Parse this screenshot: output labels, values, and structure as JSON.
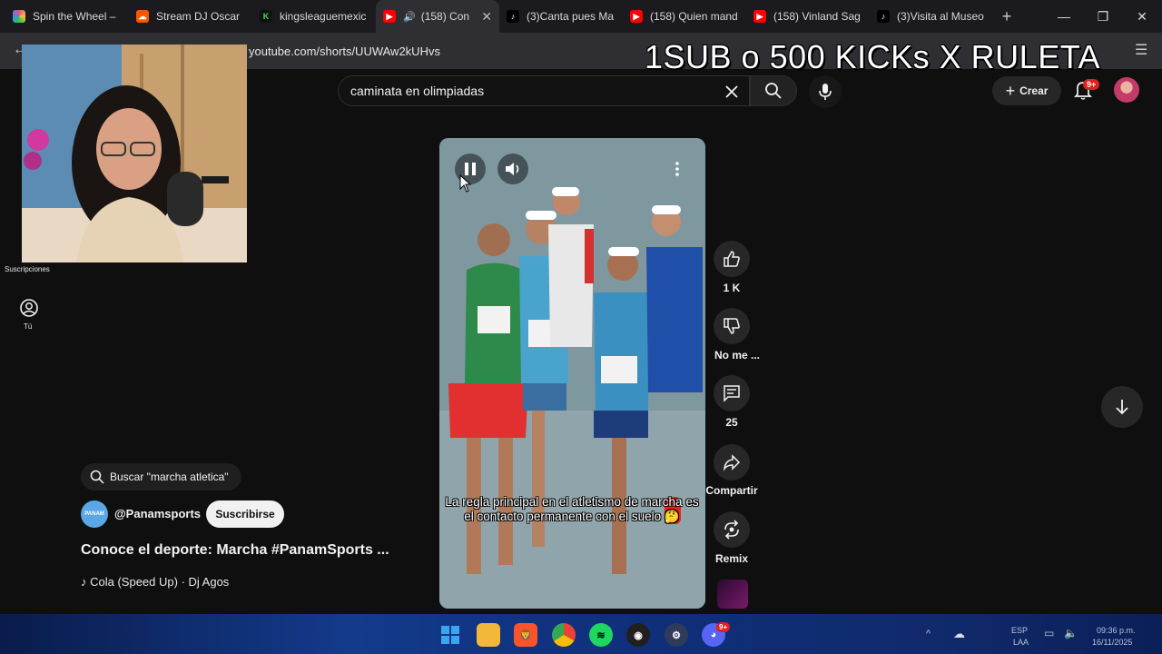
{
  "tabs": [
    {
      "label": "Spin the Wheel – ",
      "favicon": "colorful-wheel-icon",
      "color": "#e84a8a"
    },
    {
      "label": "Stream DJ Oscar",
      "favicon": "soundcloud-icon",
      "color": "#ff5500"
    },
    {
      "label": "kingsleaguemexic",
      "favicon": "kings-league-icon",
      "color": "#36c24a"
    },
    {
      "label": "(158) Con",
      "favicon": "youtube-icon",
      "color": "#ff0000",
      "active": true
    },
    {
      "label": "(3)Canta pues Ma",
      "favicon": "tiktok-icon",
      "color": "#000000"
    },
    {
      "label": "(158) Quien mand",
      "favicon": "youtube-icon",
      "color": "#ff0000"
    },
    {
      "label": "(158) Vinland Sag",
      "favicon": "youtube-icon",
      "color": "#ff0000"
    },
    {
      "label": "(3)Visita al Museo",
      "favicon": "tiktok-icon",
      "color": "#000000"
    }
  ],
  "address": {
    "url": "youtube.com/shorts/UUWAw2kUHvs"
  },
  "overlay_banner": "1SUB o 500 KICKs X RULETA",
  "header": {
    "search_query": "caminata en olimpiadas",
    "create_label": "Crear",
    "notification_count": "9+"
  },
  "nav": {
    "subscriptions_label": "Suscripciones",
    "you_label": "Tú"
  },
  "video": {
    "caption": "La regla principal en el atletismo de marcha es el contacto permanente con el suelo 🤔"
  },
  "actions": {
    "likes": "1 K",
    "dislike_label": "No me ...",
    "comments": "25",
    "share_label": "Compartir",
    "remix_label": "Remix"
  },
  "info": {
    "search_chip": "Buscar \"marcha atletica\"",
    "channel": "@Panamsports",
    "subscribe_label": "Suscribirse",
    "title": "Conoce el deporte: Marcha #PanamSports ...",
    "music": "Cola (Speed Up) · Dj Agos"
  },
  "taskbar": {
    "lang": "ESP",
    "lang2": "LAA",
    "time": "09:36 p.m.",
    "date": "16/11/2025",
    "discord_badge": "9+"
  },
  "colors": {
    "accent_red": "#ff0000",
    "background": "#0f0f0f",
    "badge_red": "#e02020"
  }
}
